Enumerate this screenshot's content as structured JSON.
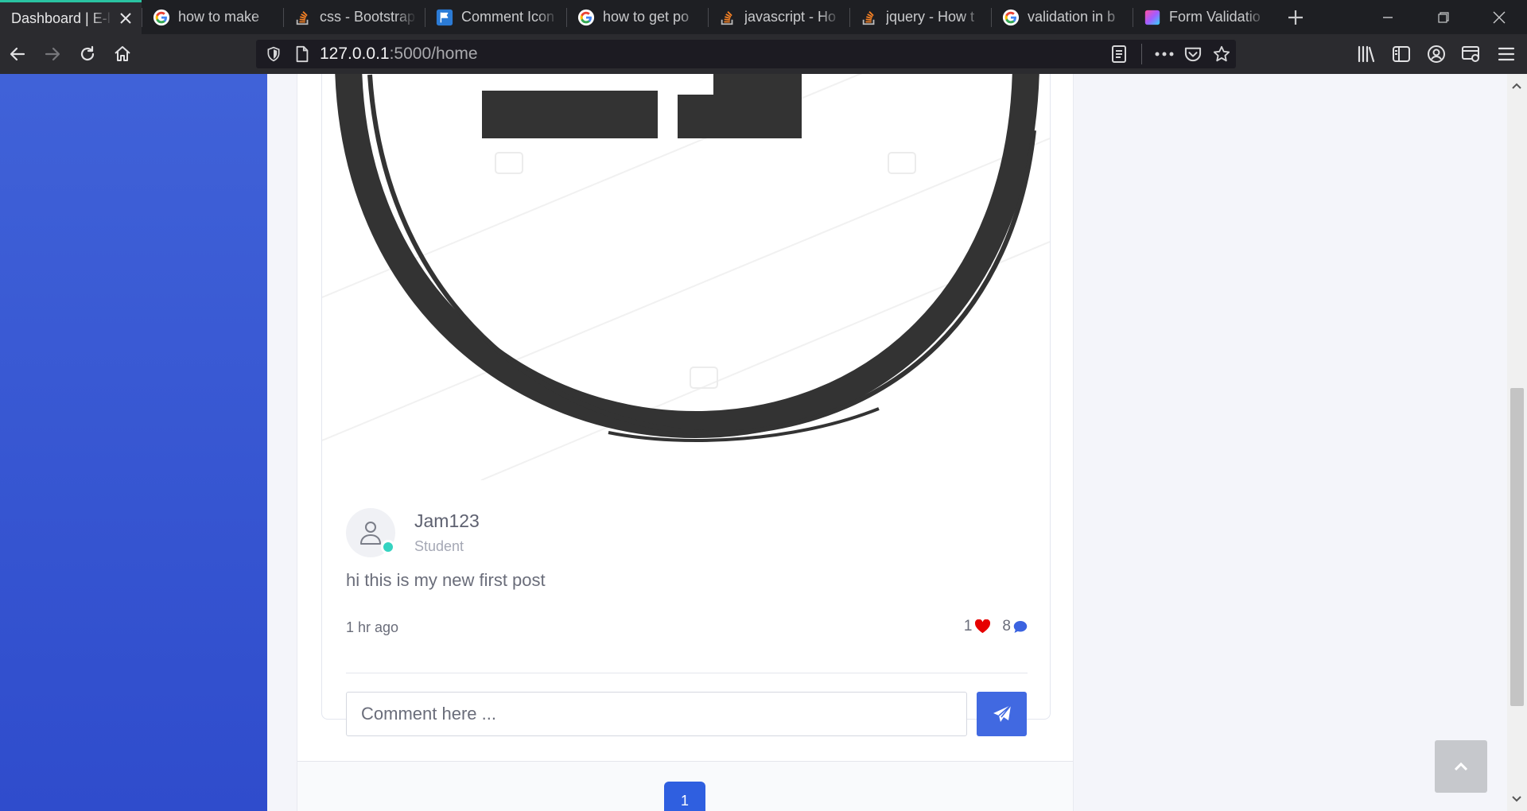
{
  "browser": {
    "tabs": [
      {
        "title": "Dashboard | E-l",
        "favicon": "none",
        "active": true
      },
      {
        "title": "how to make",
        "favicon": "google-icon"
      },
      {
        "title": "css - Bootstrap",
        "favicon": "stackoverflow-icon"
      },
      {
        "title": "Comment Icon",
        "favicon": "flag-icon"
      },
      {
        "title": "how to get po",
        "favicon": "google-icon"
      },
      {
        "title": "javascript - Ho",
        "favicon": "stackoverflow-icon"
      },
      {
        "title": "jquery - How t",
        "favicon": "stackoverflow-icon"
      },
      {
        "title": "validation in b",
        "favicon": "google-icon"
      },
      {
        "title": "Form Validatio",
        "favicon": "gradient-square-icon"
      }
    ],
    "url": {
      "host": "127.0.0.1",
      "rest": ":5000/home"
    },
    "accent_color": "#2ac3a2"
  },
  "post": {
    "author_name": "Jam123",
    "author_role": "Student",
    "text": "hi this is my new first post",
    "time": "1 hr ago",
    "likes": "1",
    "comments": "8",
    "comment_placeholder": "Comment here ...",
    "like_color": "#e60000",
    "comment_icon_color": "#3b63e0"
  },
  "pagination": {
    "current_page": "1"
  },
  "colors": {
    "sidebar": "#4062d8",
    "primary_button": "#4169e1",
    "online_dot": "#35d3c1"
  }
}
